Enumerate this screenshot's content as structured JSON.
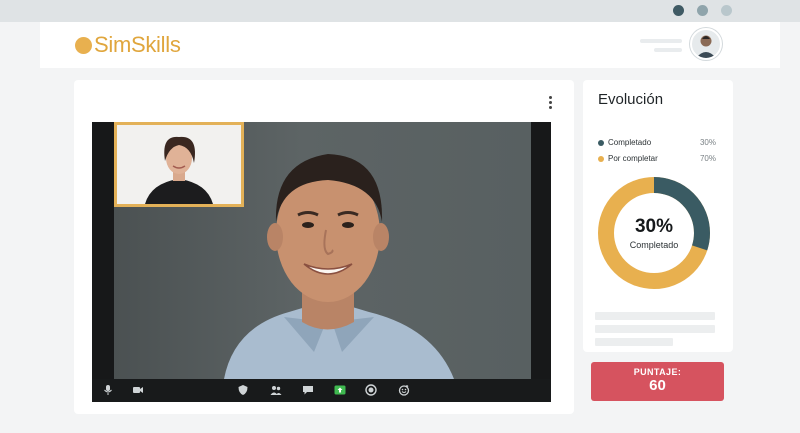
{
  "app": {
    "brand": "SimSkills"
  },
  "header": {
    "user_avatar": "user-avatar"
  },
  "video": {
    "options_icon": "more-vertical-icon",
    "controls": [
      {
        "name": "mic-icon"
      },
      {
        "name": "camera-icon"
      },
      {
        "name": "security-icon"
      },
      {
        "name": "participants-icon"
      },
      {
        "name": "chat-icon"
      },
      {
        "name": "share-screen-icon",
        "color": "#3fb950"
      },
      {
        "name": "record-icon"
      },
      {
        "name": "reactions-icon"
      }
    ]
  },
  "evolution": {
    "title": "Evolución",
    "legend": [
      {
        "label": "Completado",
        "percent": "30%",
        "color": "#3a5b63"
      },
      {
        "label": "Por completar",
        "percent": "70%",
        "color": "#e8b04f"
      }
    ],
    "progress": 0.3,
    "center_value": "30%",
    "center_label": "Completado"
  },
  "score": {
    "label": "PUNTAJE:",
    "value": "60",
    "color": "#d6535f"
  }
}
